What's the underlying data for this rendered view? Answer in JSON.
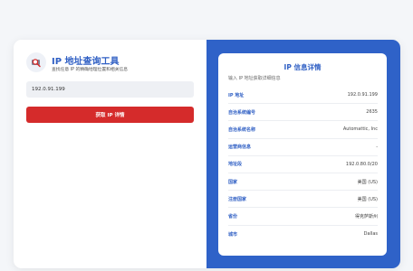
{
  "app": {
    "title": "IP 地址查询工具",
    "subtitle": "查找任意 IP 的精确地理位置和相关信息"
  },
  "search": {
    "value": "192.0.91.199",
    "button_label": "获取 IP 详情"
  },
  "details": {
    "title": "IP 信息详情",
    "subtitle": "输入 IP 地址获取详细信息",
    "rows": [
      {
        "label": "IP 地址",
        "value": "192.0.91.199"
      },
      {
        "label": "自治系统编号",
        "value": "2635"
      },
      {
        "label": "自治系统名称",
        "value": "Automattic, Inc"
      },
      {
        "label": "运营商信息",
        "value": "-"
      },
      {
        "label": "地址段",
        "value": "192.0.80.0/20"
      },
      {
        "label": "国家",
        "value": "美国 (US)"
      },
      {
        "label": "注册国家",
        "value": "美国 (US)"
      },
      {
        "label": "省份",
        "value": "得克萨斯州"
      },
      {
        "label": "城市",
        "value": "Dallas"
      }
    ]
  },
  "colors": {
    "accent": "#2f5fc4",
    "panel_background": "#2f62c8",
    "button": "#d52b2b"
  },
  "icons": {
    "logo": "search-location-icon"
  }
}
